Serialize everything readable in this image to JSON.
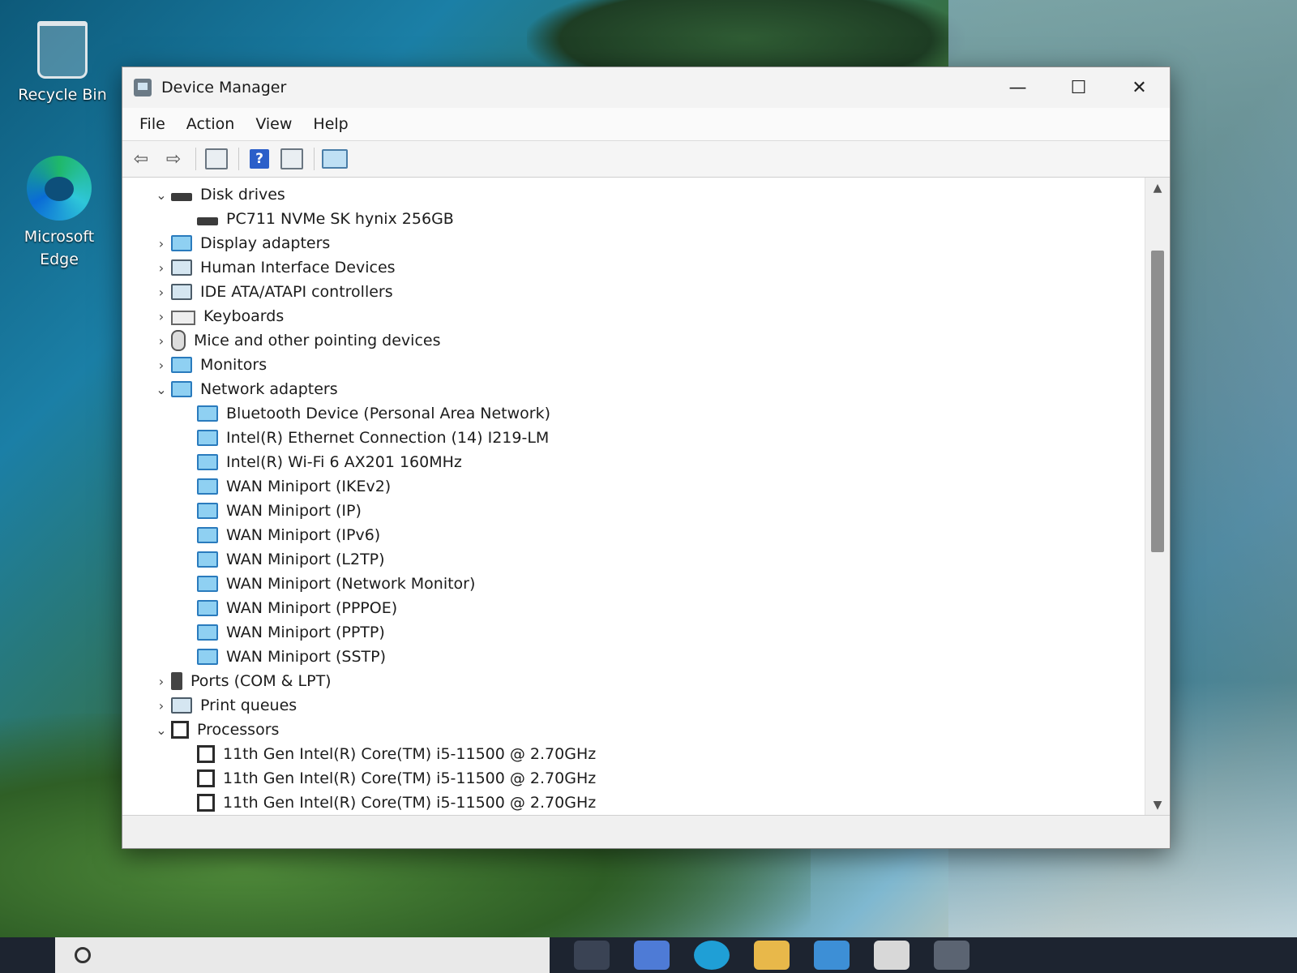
{
  "desktop": {
    "icons": [
      {
        "label": "Recycle Bin"
      },
      {
        "label": "Microsoft Edge"
      }
    ]
  },
  "window": {
    "title": "Device Manager",
    "controls": {
      "minimize": "—",
      "maximize": "☐",
      "close": "✕"
    },
    "menu": [
      "File",
      "Action",
      "View",
      "Help"
    ],
    "toolbar": {
      "back_icon": "back-arrow-icon",
      "forward_icon": "forward-arrow-icon",
      "help_glyph": "?"
    },
    "tree": [
      {
        "label": "Disk drives",
        "level": 0,
        "state": "expanded",
        "icon": "disk-icon"
      },
      {
        "label": "PC711 NVMe SK hynix 256GB",
        "level": 1,
        "icon": "disk-icon"
      },
      {
        "label": "Display adapters",
        "level": 0,
        "state": "collapsed",
        "icon": "display-adapter-icon"
      },
      {
        "label": "Human Interface Devices",
        "level": 0,
        "state": "collapsed",
        "icon": "hid-icon"
      },
      {
        "label": "IDE ATA/ATAPI controllers",
        "level": 0,
        "state": "collapsed",
        "icon": "ide-controller-icon"
      },
      {
        "label": "Keyboards",
        "level": 0,
        "state": "collapsed",
        "icon": "keyboard-icon"
      },
      {
        "label": "Mice and other pointing devices",
        "level": 0,
        "state": "collapsed",
        "icon": "mouse-icon"
      },
      {
        "label": "Monitors",
        "level": 0,
        "state": "collapsed",
        "icon": "monitor-icon"
      },
      {
        "label": "Network adapters",
        "level": 0,
        "state": "expanded",
        "icon": "network-adapter-icon"
      },
      {
        "label": "Bluetooth Device (Personal Area Network)",
        "level": 1,
        "icon": "network-adapter-icon"
      },
      {
        "label": "Intel(R) Ethernet Connection (14) I219-LM",
        "level": 1,
        "icon": "network-adapter-icon"
      },
      {
        "label": "Intel(R) Wi-Fi 6 AX201 160MHz",
        "level": 1,
        "icon": "network-adapter-icon"
      },
      {
        "label": "WAN Miniport (IKEv2)",
        "level": 1,
        "icon": "network-adapter-icon"
      },
      {
        "label": "WAN Miniport (IP)",
        "level": 1,
        "icon": "network-adapter-icon"
      },
      {
        "label": "WAN Miniport (IPv6)",
        "level": 1,
        "icon": "network-adapter-icon"
      },
      {
        "label": "WAN Miniport (L2TP)",
        "level": 1,
        "icon": "network-adapter-icon"
      },
      {
        "label": "WAN Miniport (Network Monitor)",
        "level": 1,
        "icon": "network-adapter-icon"
      },
      {
        "label": "WAN Miniport (PPPOE)",
        "level": 1,
        "icon": "network-adapter-icon"
      },
      {
        "label": "WAN Miniport (PPTP)",
        "level": 1,
        "icon": "network-adapter-icon"
      },
      {
        "label": "WAN Miniport (SSTP)",
        "level": 1,
        "icon": "network-adapter-icon"
      },
      {
        "label": "Ports (COM & LPT)",
        "level": 0,
        "state": "collapsed",
        "icon": "port-icon"
      },
      {
        "label": "Print queues",
        "level": 0,
        "state": "collapsed",
        "icon": "printer-icon"
      },
      {
        "label": "Processors",
        "level": 0,
        "state": "expanded",
        "icon": "processor-icon"
      },
      {
        "label": "11th Gen Intel(R) Core(TM) i5-11500 @ 2.70GHz",
        "level": 1,
        "icon": "processor-icon"
      },
      {
        "label": "11th Gen Intel(R) Core(TM) i5-11500 @ 2.70GHz",
        "level": 1,
        "icon": "processor-icon"
      },
      {
        "label": "11th Gen Intel(R) Core(TM) i5-11500 @ 2.70GHz",
        "level": 1,
        "icon": "processor-icon"
      }
    ]
  },
  "colors": {
    "window_bg": "#fafafa",
    "network_icon": "#2a7bbd"
  }
}
